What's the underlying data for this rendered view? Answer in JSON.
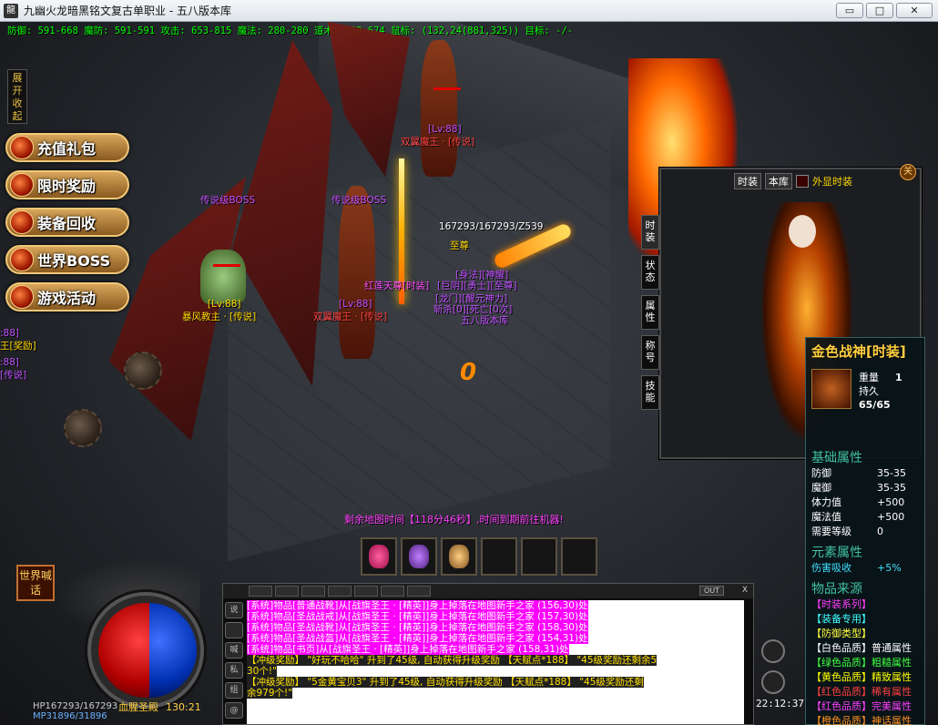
{
  "window": {
    "title": "九幽火龙暗黑铭文复古单职业 - 五八版本库",
    "minimize": "▭",
    "restore": "□",
    "close": "✕"
  },
  "status": {
    "text": "防御: 591-668 魔防: 591-591 攻击: 653-815 魔法: 280-280 道术: 529-674 鼠标: (132,24(881,325)) 目标: -/-"
  },
  "side_toggle": "展开收起",
  "menu": [
    {
      "label": "充值礼包"
    },
    {
      "label": "限时奖励"
    },
    {
      "label": "装备回收"
    },
    {
      "label": "世界BOSS"
    },
    {
      "label": "游戏活动"
    }
  ],
  "world": {
    "labels": {
      "boss1": "传说级BOSS",
      "boss2": "传说级BOSS",
      "demon_top_lv": "[Lv:88]",
      "demon_top": "双翼魔王 · [传说]",
      "demon_mid_lv": "[Lv:88]",
      "demon_mid": "双翼魔王 · [传说]",
      "storm_lv": "[Lv:88]",
      "storm": "暴风教主 · [传说]",
      "player_hp": "167293/167293/Z539",
      "player_title": "至尊",
      "left_edge1": ":88]",
      "left_edge2": "王[奖励]",
      "left_edge3": ":88]",
      "left_edge4": "[传说]",
      "npc1": "红莲天尊[时装]",
      "npc2": "[身法][神醒]",
      "npc3": "[巨阴][勇士][至尊]",
      "npc4": "[龙门][醒元神力]",
      "npc5": "斩杀[0][死亡[0次]",
      "npc6": "五八版本库",
      "damage": "0"
    }
  },
  "time_notice": "剩余地图时间【118分46秒】,时间到期前往机器!",
  "char_panel": {
    "tabs": [
      "时装",
      "状态",
      "属性",
      "称号",
      "技能"
    ],
    "header_btn1": "时装",
    "header_btn2": "本库",
    "header_lbl": "外显时装",
    "close": "关"
  },
  "item_tip": {
    "title": "金色战神[时装]",
    "weight_k": "重量",
    "weight_v": "1",
    "dura_k": "持久",
    "dura_v": "65/65",
    "base_title": "基础属性",
    "base": [
      {
        "k": "防御",
        "v": "35-35"
      },
      {
        "k": "魔御",
        "v": "35-35"
      },
      {
        "k": "体力值",
        "v": "+500"
      },
      {
        "k": "魔法值",
        "v": "+500"
      },
      {
        "k": "需要等级",
        "v": "0"
      }
    ],
    "elem_title": "元素属性",
    "elem_k": "伤害吸收",
    "elem_v": "+5%",
    "src_title": "物品来源",
    "sources": [
      {
        "tag": "【时装系列】",
        "desc": "",
        "color": "#ff40ff"
      },
      {
        "tag": "【装备专用】",
        "desc": "",
        "color": "#40ffff"
      },
      {
        "tag": "【防御类型】",
        "desc": "",
        "color": "#ffff40"
      },
      {
        "tag": "【白色品质】",
        "desc": "普通属性",
        "color": "#ffffff"
      },
      {
        "tag": "【绿色品质】",
        "desc": "粗糙属性",
        "color": "#40ff40"
      },
      {
        "tag": "【黄色品质】",
        "desc": "精致属性",
        "color": "#ffff00"
      },
      {
        "tag": "【红色品质】",
        "desc": "稀有属性",
        "color": "#ff4040"
      },
      {
        "tag": "【红色品质】",
        "desc": "完美属性",
        "color": "#ff40ff"
      },
      {
        "tag": "【橙色品质】",
        "desc": "神话属性",
        "color": "#ff9020"
      }
    ]
  },
  "bottom": {
    "world_chat": "世界喊话",
    "hp": "HP167293/167293",
    "mp": "MP31896/31896",
    "map": "血腥圣殿",
    "coord": "130:21",
    "clock": "22:12:37",
    "chat_tabs": [
      "",
      "",
      "",
      "",
      "",
      "",
      ""
    ],
    "chat_out": "OUT",
    "chat_close": "X",
    "chat_side": [
      "说",
      "",
      "喊",
      "私",
      "组",
      "@"
    ],
    "chat": [
      {
        "cls": "sys",
        "text": "[系统]物品[普通战靴]从[战旗圣王 · [精英]]身上掉落在地图新手之家 (156,30)处"
      },
      {
        "cls": "sys",
        "text": "[系统]物品[圣战战戒]从[战旗圣王 · [精英]]身上掉落在地图新手之家 (157,30)处"
      },
      {
        "cls": "sys",
        "text": "[系统]物品[圣战战靴]从[战旗圣王 · [精英]]身上掉落在地图新手之家 (158,30)处"
      },
      {
        "cls": "sys",
        "text": "[系统]物品[圣战战盔]从[战旗圣王 · [精英]]身上掉落在地图新手之家 (154,31)处"
      },
      {
        "cls": "sys",
        "text": "[系统]物品[书页]从[战旗圣王 · [精英]]身上掉落在地图新手之家 (158,31)处"
      },
      {
        "cls": "up",
        "text": "【冲级奖励】 \"好玩不哈哈\" 升到了45级, 自动获得升级奖励 【天赋点*188】 \"45级奖励还剩余5"
      },
      {
        "cls": "up",
        "text": "30个!\""
      },
      {
        "cls": "up",
        "text": "【冲级奖励】 \"5金黄宝贝3\" 升到了45级, 自动获得升级奖励 【天赋点*188】 \"45级奖励还剩"
      },
      {
        "cls": "up",
        "text": "余979个!\""
      }
    ]
  }
}
